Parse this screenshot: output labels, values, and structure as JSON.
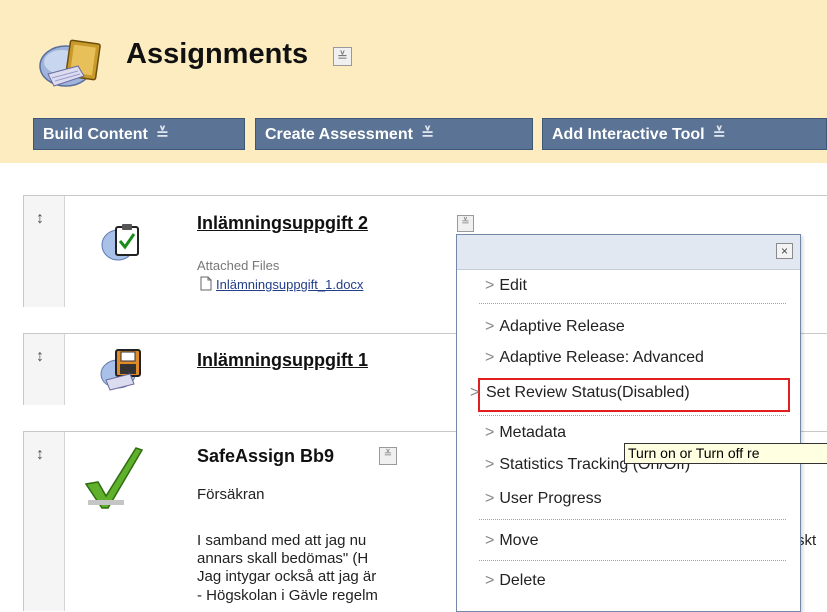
{
  "page": {
    "title": "Assignments",
    "title_menu_glyph": "≚"
  },
  "toolbar": {
    "items": [
      {
        "label": "Build Content"
      },
      {
        "label": "Create Assessment"
      },
      {
        "label": "Add Interactive Tool"
      }
    ],
    "chevron": "≚"
  },
  "items": [
    {
      "title": "Inlämningsuppgift 2",
      "attached_label": "Attached Files",
      "file_name": "Inlämningsuppgift_1.docx",
      "icon": "assignment-clipboard-icon"
    },
    {
      "title": "Inlämningsuppgift 1",
      "icon": "floppy-disk-icon"
    },
    {
      "title": "SafeAssign Bb9",
      "subtitle": "Försäkran",
      "body_line1": "I samband med att jag nu",
      "body_line1_tail": "skt",
      "body_line2": "annars skall bedömas\" (H",
      "body_line3": "Jag intygar också att jag är",
      "body_line4": "- Högskolan i Gävle regelm",
      "icon": "green-checkmark-icon"
    }
  ],
  "context_menu": {
    "close_glyph": "×",
    "items": [
      {
        "label": "Edit"
      },
      {
        "label": "Adaptive Release"
      },
      {
        "label": "Adaptive Release: Advanced"
      },
      {
        "label": "Set Review Status(Disabled)"
      },
      {
        "label": "Metadata"
      },
      {
        "label": "Statistics Tracking (On/Off)"
      },
      {
        "label": "User Progress"
      },
      {
        "label": "Move"
      },
      {
        "label": "Delete"
      }
    ],
    "arrow": ">"
  },
  "tooltip": {
    "text": "Turn on or Turn off re"
  },
  "drag_glyph": "↕",
  "colors": {
    "header_bg": "#fdecc0",
    "toolbar_btn": "#5b7394",
    "highlight": "#e02020",
    "tooltip_bg": "#ffffe1"
  }
}
